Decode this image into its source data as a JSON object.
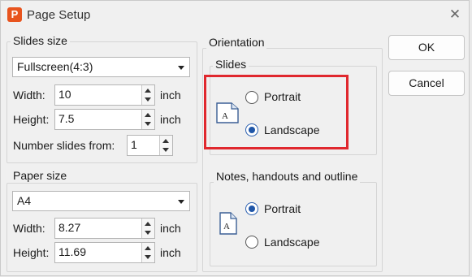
{
  "window": {
    "title": "Page Setup",
    "app_icon_letter": "P",
    "close_glyph": "✕"
  },
  "slides_size": {
    "label": "Slides size",
    "preset": "Fullscreen(4:3)",
    "width_label": "Width:",
    "width_value": "10",
    "width_unit": "inch",
    "height_label": "Height:",
    "height_value": "7.5",
    "height_unit": "inch",
    "number_from_label": "Number slides from:",
    "number_from_value": "1"
  },
  "paper_size": {
    "label": "Paper size",
    "preset": "A4",
    "width_label": "Width:",
    "width_value": "8.27",
    "width_unit": "inch",
    "height_label": "Height:",
    "height_value": "11.69",
    "height_unit": "inch"
  },
  "orientation": {
    "label": "Orientation",
    "slides": {
      "label": "Slides",
      "portrait": "Portrait",
      "landscape": "Landscape",
      "selected": "landscape"
    },
    "notes": {
      "label": "Notes, handouts and outline",
      "portrait": "Portrait",
      "landscape": "Landscape",
      "selected": "portrait"
    },
    "page_icon_letter": "A"
  },
  "buttons": {
    "ok": "OK",
    "cancel": "Cancel"
  },
  "colors": {
    "accent": "#1f56a8",
    "highlight": "#e0282e",
    "app_icon": "#e8541e"
  }
}
